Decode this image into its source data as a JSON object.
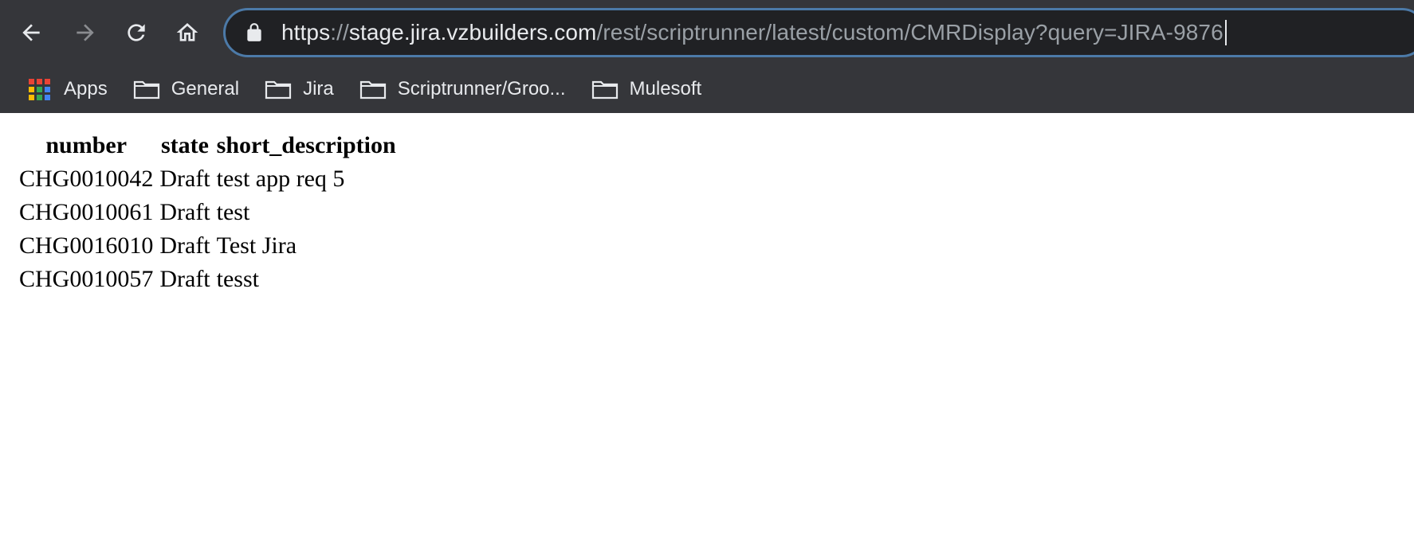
{
  "browser": {
    "url": {
      "scheme": "https",
      "separator": "://",
      "host": "stage.jira.vzbuilders.com",
      "path": "/rest/scriptrunner/latest/custom/CMRDisplay?query=JIRA-9876"
    },
    "icons": {
      "back": "arrow-left-icon",
      "forward": "arrow-right-icon",
      "reload": "reload-icon",
      "home": "home-icon",
      "lock": "lock-icon"
    },
    "colors": {
      "toolbar_bg": "#35363a",
      "omnibox_bg": "#202124",
      "omnibox_border": "#4c7aa8",
      "text": "#e8eaed",
      "dim_text": "#9aa0a6"
    },
    "bookmarks": [
      {
        "label": "Apps",
        "icon": "apps-grid-icon"
      },
      {
        "label": "General",
        "icon": "folder-icon"
      },
      {
        "label": "Jira",
        "icon": "folder-icon"
      },
      {
        "label": "Scriptrunner/Groo...",
        "icon": "folder-icon"
      },
      {
        "label": "Mulesoft",
        "icon": "folder-icon"
      }
    ]
  },
  "table": {
    "headers": [
      "number",
      "state",
      "short_description"
    ],
    "rows": [
      {
        "number": "CHG0010042",
        "state": "Draft",
        "short_description": "test app req 5"
      },
      {
        "number": "CHG0010061",
        "state": "Draft",
        "short_description": "test"
      },
      {
        "number": "CHG0016010",
        "state": "Draft",
        "short_description": "Test Jira"
      },
      {
        "number": "CHG0010057",
        "state": "Draft",
        "short_description": "tesst"
      }
    ]
  }
}
